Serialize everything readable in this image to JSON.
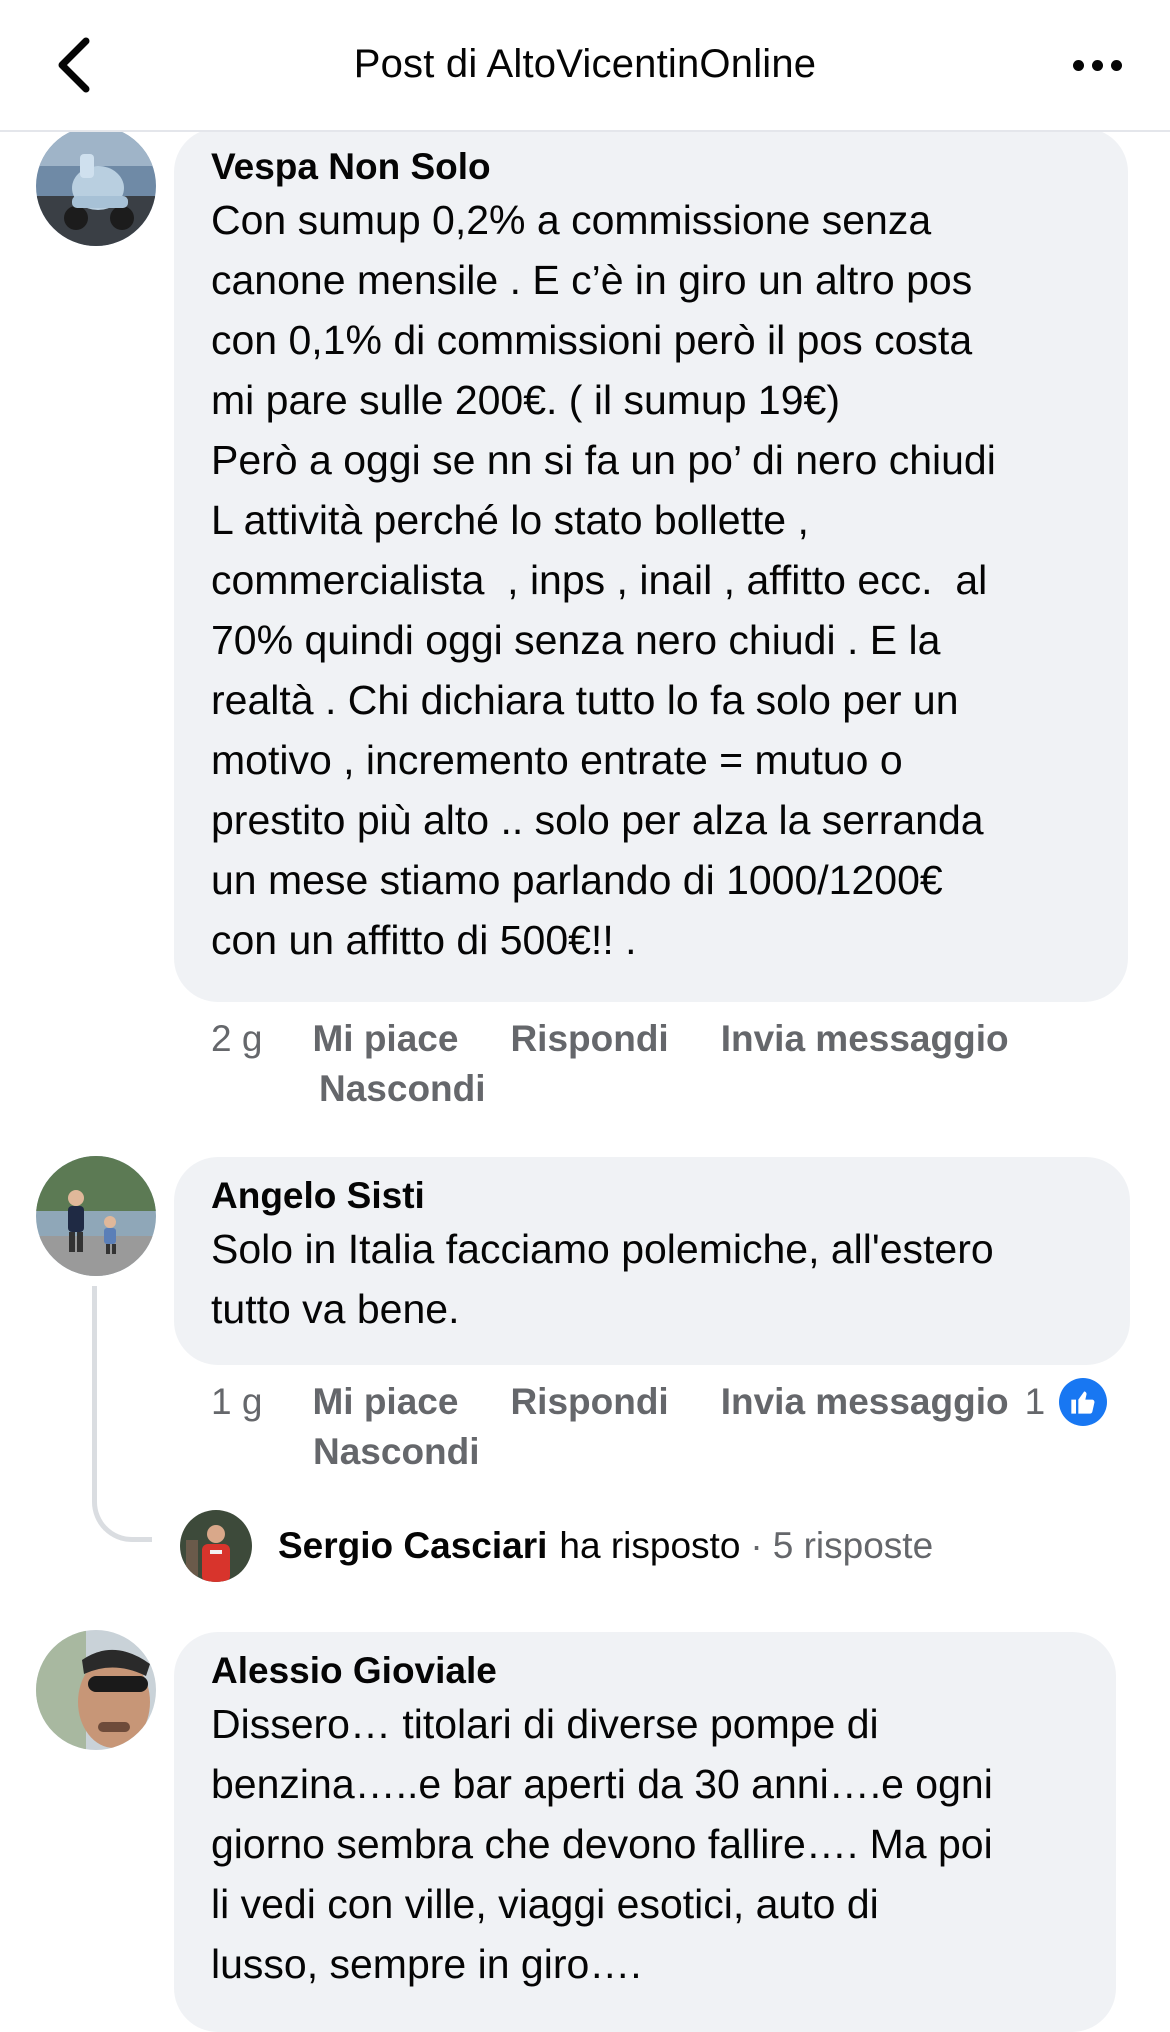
{
  "header": {
    "title": "Post di AltoVicentinOnline"
  },
  "comments": [
    {
      "author": "Vespa Non Solo",
      "text": "Con sumup 0,2% a commissione senza\ncanone mensile . E c’è in giro un altro pos\ncon 0,1% di commissioni però il pos costa\nmi pare sulle 200€. ( il sumup 19€)\nPerò a oggi se nn si fa un po’ di nero chiudi\nL attività perché lo stato bollette ,\ncommercialista  , inps , inail , affitto ecc.  al\n70% quindi oggi senza nero chiudi . E la\nrealtà . Chi dichiara tutto lo fa solo per un\nmotivo , incremento entrate = mutuo o\nprestito più alto .. solo per alza la serranda\nun mese stiamo parlando di 1000/1200€\ncon un affitto di 500€!! .",
      "time": "2 g",
      "like": "Mi piace",
      "reply": "Rispondi",
      "message": "Invia messaggio",
      "hide": "Nascondi"
    },
    {
      "author": "Angelo Sisti",
      "text": "Solo in Italia facciamo polemiche, all'estero\ntutto va bene.",
      "time": "1 g",
      "like": "Mi piace",
      "reply": "Rispondi",
      "message": "Invia messaggio",
      "hide": "Nascondi",
      "like_count": "1",
      "replies": {
        "name": "Sergio Casciari",
        "verb": "ha risposto",
        "dot": "·",
        "count": "5 risposte"
      }
    },
    {
      "author": "Alessio Gioviale",
      "text": "Dissero… titolari di diverse pompe di\nbenzina…..e bar aperti da 30 anni….e ogni\ngiorno sembra che devono fallire…. Ma poi\nli vedi con ville, viaggi esotici, auto di\nlusso, sempre in giro…."
    }
  ],
  "icons": {
    "back": "chevron-left-icon",
    "more": "more-horizontal-icon",
    "like_badge": "thumbs-up-icon"
  },
  "colors": {
    "bubble": "#f0f2f5",
    "secondary_text": "#65676b",
    "like_blue": "#1877f2"
  }
}
